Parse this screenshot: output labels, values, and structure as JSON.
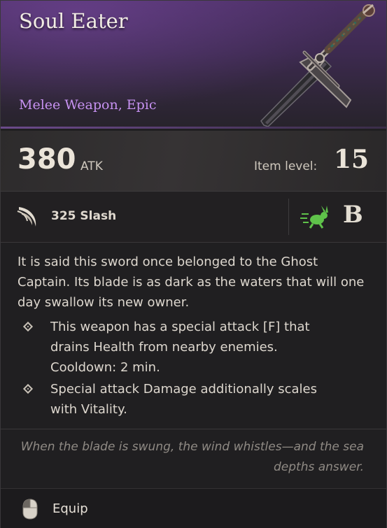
{
  "item": {
    "name": "Soul Eater",
    "type": "Melee Weapon, Epic",
    "rarity_color": "#c792f2"
  },
  "stats": {
    "atk_value": "380",
    "atk_label": "ATK",
    "item_level_label": "Item level:",
    "item_level_value": "15"
  },
  "damage": {
    "icon": "slash-icon",
    "text": "325 Slash",
    "speed_icon": "rabbit-icon",
    "speed_color": "#5fc24a",
    "speed_grade": "B"
  },
  "description": "It is said this sword once belonged to the Ghost Captain. Its blade is as dark as the waters that will one day swallow its new owner.",
  "effects": [
    {
      "lines": [
        "This weapon has a special attack [F] that",
        "drains Health from nearby enemies.",
        "Cooldown: 2 min."
      ]
    },
    {
      "lines": [
        "Special attack Damage additionally scales",
        "with Vitality."
      ]
    }
  ],
  "flavor": {
    "line1": "When the blade is swung, the wind whistles—and the sea",
    "line2": "depths answer."
  },
  "footer": {
    "equip_label": "Equip",
    "icon": "mouse-icon"
  }
}
